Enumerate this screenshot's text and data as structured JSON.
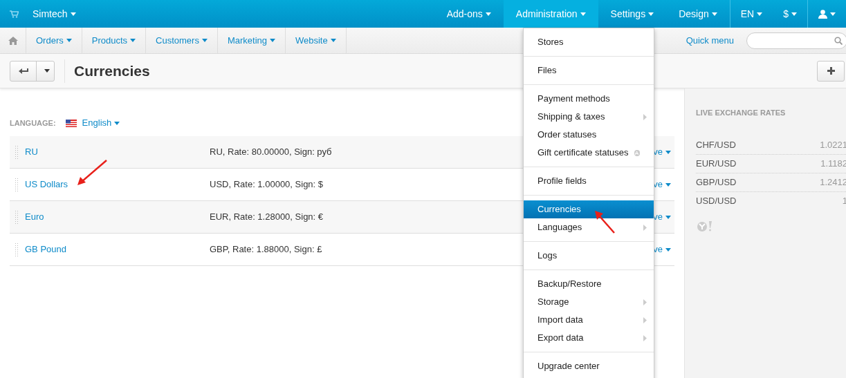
{
  "top_bar": {
    "store": "Simtech",
    "menus": [
      {
        "label": "Add-ons",
        "selected": false
      },
      {
        "label": "Administration",
        "selected": true
      },
      {
        "label": "Settings",
        "selected": false
      },
      {
        "label": "Design",
        "selected": false
      }
    ],
    "language": "EN",
    "currency": "$"
  },
  "main_nav": {
    "items": [
      "Orders",
      "Products",
      "Customers",
      "Marketing",
      "Website"
    ],
    "quick_menu": "Quick menu"
  },
  "page_title": "Currencies",
  "language_selector": {
    "label": "LANGUAGE:",
    "value": "English"
  },
  "currencies": [
    {
      "name": "RU",
      "details": "RU, Rate: 80.00000, Sign: руб",
      "status": "ve"
    },
    {
      "name": "US Dollars",
      "details": "USD, Rate: 1.00000, Sign: $",
      "status": "ve"
    },
    {
      "name": "Euro",
      "details": "EUR, Rate: 1.28000, Sign: €",
      "status": "ve"
    },
    {
      "name": "GB Pound",
      "details": "GBP, Rate: 1.88000, Sign: £",
      "status": "ve"
    }
  ],
  "administration_menu": [
    [
      {
        "label": "Stores",
        "selected": false,
        "submenu": false,
        "note_icon": false
      }
    ],
    [
      {
        "label": "Files",
        "selected": false,
        "submenu": false,
        "note_icon": false
      }
    ],
    [
      {
        "label": "Payment methods",
        "selected": false,
        "submenu": false,
        "note_icon": false
      },
      {
        "label": "Shipping & taxes",
        "selected": false,
        "submenu": true,
        "note_icon": false
      },
      {
        "label": "Order statuses",
        "selected": false,
        "submenu": false,
        "note_icon": false
      },
      {
        "label": "Gift certificate statuses",
        "selected": false,
        "submenu": false,
        "note_icon": true
      }
    ],
    [
      {
        "label": "Profile fields",
        "selected": false,
        "submenu": false,
        "note_icon": false
      }
    ],
    [
      {
        "label": "Currencies",
        "selected": true,
        "submenu": false,
        "note_icon": false
      },
      {
        "label": "Languages",
        "selected": false,
        "submenu": true,
        "note_icon": false
      }
    ],
    [
      {
        "label": "Logs",
        "selected": false,
        "submenu": false,
        "note_icon": false
      }
    ],
    [
      {
        "label": "Backup/Restore",
        "selected": false,
        "submenu": false,
        "note_icon": false
      },
      {
        "label": "Storage",
        "selected": false,
        "submenu": true,
        "note_icon": false
      },
      {
        "label": "Import data",
        "selected": false,
        "submenu": true,
        "note_icon": false
      },
      {
        "label": "Export data",
        "selected": false,
        "submenu": true,
        "note_icon": false
      }
    ],
    [
      {
        "label": "Upgrade center",
        "selected": false,
        "submenu": false,
        "note_icon": false
      }
    ]
  ],
  "exchange_rates": {
    "title": "LIVE EXCHANGE RATES",
    "rates": [
      {
        "pair": "CHF/USD",
        "value": "1.0221"
      },
      {
        "pair": "EUR/USD",
        "value": "1.1182"
      },
      {
        "pair": "GBP/USD",
        "value": "1.2412"
      },
      {
        "pair": "USD/USD",
        "value": "1"
      }
    ]
  }
}
